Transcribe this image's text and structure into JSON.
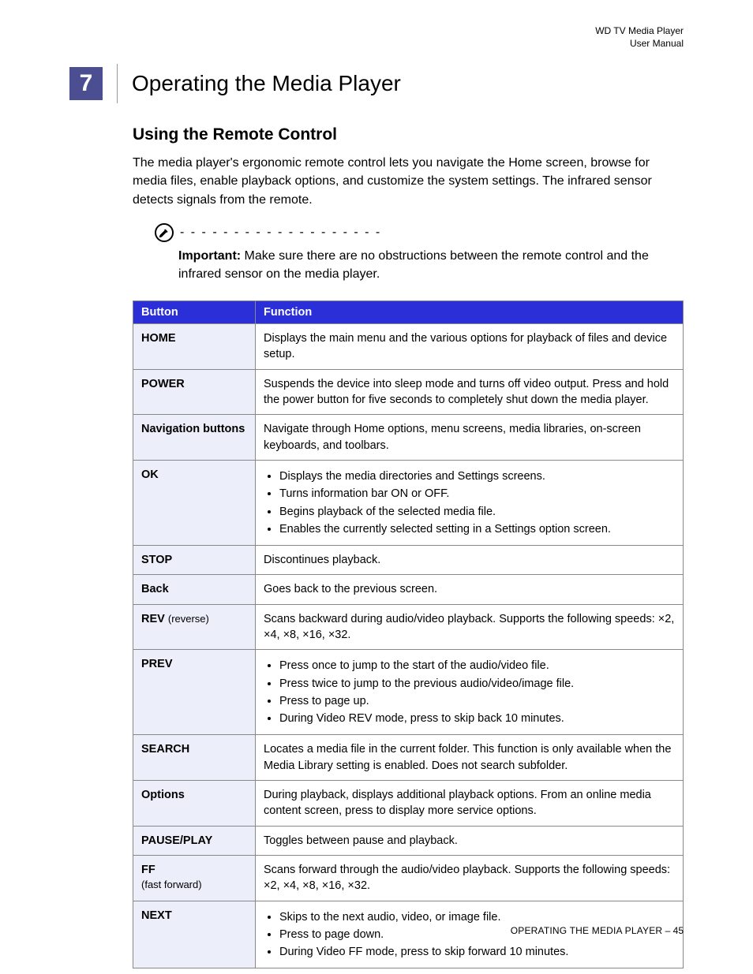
{
  "header": {
    "line1": "WD TV Media Player",
    "line2": "User Manual"
  },
  "chapter": {
    "number": "7",
    "title": "Operating the Media Player"
  },
  "section": {
    "title": "Using the Remote Control",
    "intro": "The media player's ergonomic remote control lets you navigate the Home screen, browse for media files, enable playback options, and customize the system settings. The infrared sensor detects signals from the remote."
  },
  "note": {
    "dots": "- - - - - - - - - - - - - - - - - - - - - - - - - - - - - - - - - - - - - - - - - - -",
    "label": "Important:",
    "text": " Make sure there are no obstructions between the remote control and the infrared sensor on the media player."
  },
  "table": {
    "head": {
      "c1": "Button",
      "c2": "Function"
    },
    "rows": [
      {
        "button": "HOME",
        "caps": true,
        "fn": "Displays the main menu and the various options for playback of files and device setup."
      },
      {
        "button": "POWER",
        "caps": true,
        "fn": "Suspends the device into sleep mode and turns off video output. Press and hold the power button for five seconds to completely shut down the media player."
      },
      {
        "button": "Navigation buttons",
        "caps": false,
        "fn": "Navigate through Home options, menu screens, media libraries, on-screen keyboards, and toolbars."
      },
      {
        "button": "OK",
        "caps": true,
        "fn_list": [
          "Displays the media directories and Settings screens.",
          "Turns information bar ON or OFF.",
          "Begins playback of the selected media file.",
          "Enables the currently selected setting in a Settings option screen."
        ]
      },
      {
        "button": "STOP",
        "caps": true,
        "fn": "Discontinues playback."
      },
      {
        "button": "Back",
        "caps": false,
        "fn": "Goes back to the previous screen."
      },
      {
        "button": "REV",
        "sublabel": "(reverse)",
        "caps": true,
        "fn": "Scans backward during audio/video playback. Supports the following speeds: ×2, ×4, ×8, ×16, ×32."
      },
      {
        "button": "PREV",
        "caps": true,
        "fn_list": [
          "Press once to jump to the start of the audio/video file.",
          "Press twice to jump to the previous audio/video/image file.",
          "Press to page up.",
          "During Video REV mode, press to skip back 10 minutes."
        ]
      },
      {
        "button": "SEARCH",
        "caps": true,
        "fn": "Locates a media file in the current folder. This function is only available when the Media Library setting is enabled. Does not search subfolder."
      },
      {
        "button": "Options",
        "caps": false,
        "fn": "During playback, displays additional playback options. From an online media content screen, press to display more service options."
      },
      {
        "button": "PAUSE/PLAY",
        "caps": true,
        "fn": "Toggles between pause and playback."
      },
      {
        "button": "FF",
        "sublabel": "(fast forward)",
        "caps": true,
        "fn": "Scans forward through the audio/video playback. Supports the following speeds: ×2, ×4, ×8, ×16, ×32."
      },
      {
        "button": "NEXT",
        "caps": true,
        "fn_list": [
          "Skips to the next audio, video, or image file.",
          "Press to page down.",
          "During Video FF mode, press to skip forward 10 minutes."
        ]
      }
    ]
  },
  "footer": {
    "section": "OPERATING THE MEDIA PLAYER",
    "sep": " – ",
    "page": "45"
  }
}
